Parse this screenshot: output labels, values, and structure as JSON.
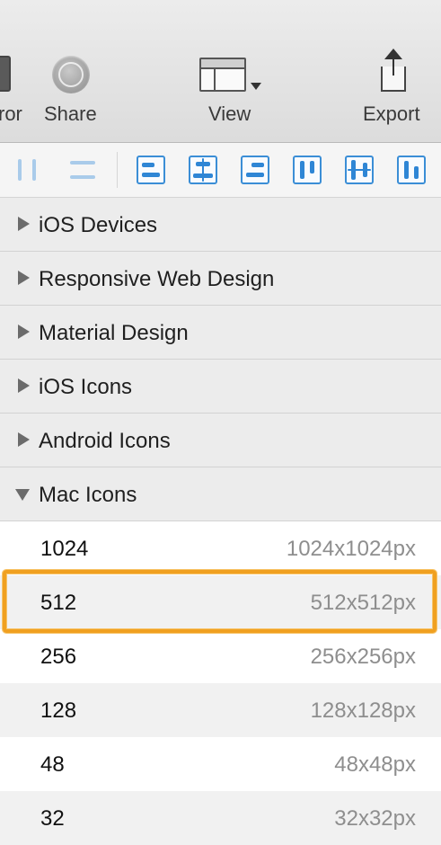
{
  "toolbar": {
    "mirror_label": "ror",
    "share_label": "Share",
    "view_label": "View",
    "export_label": "Export"
  },
  "align_buttons": [
    "distribute-horizontal",
    "distribute-vertical",
    "align-left",
    "align-horizontal-center",
    "align-right",
    "align-top",
    "align-vertical-center",
    "align-bottom"
  ],
  "library": {
    "sections": [
      {
        "label": "iOS Devices",
        "expanded": false
      },
      {
        "label": "Responsive Web Design",
        "expanded": false
      },
      {
        "label": "Material Design",
        "expanded": false
      },
      {
        "label": "iOS Icons",
        "expanded": false
      },
      {
        "label": "Android Icons",
        "expanded": false
      },
      {
        "label": "Mac Icons",
        "expanded": true
      }
    ],
    "mac_icons": [
      {
        "name": "1024",
        "size": "1024x1024px"
      },
      {
        "name": "512",
        "size": "512x512px",
        "selected": true
      },
      {
        "name": "256",
        "size": "256x256px"
      },
      {
        "name": "128",
        "size": "128x128px"
      },
      {
        "name": "48",
        "size": "48x48px"
      },
      {
        "name": "32",
        "size": "32x32px"
      }
    ]
  },
  "colors": {
    "highlight": "#f0a020",
    "align_accent": "#2f86d5"
  }
}
